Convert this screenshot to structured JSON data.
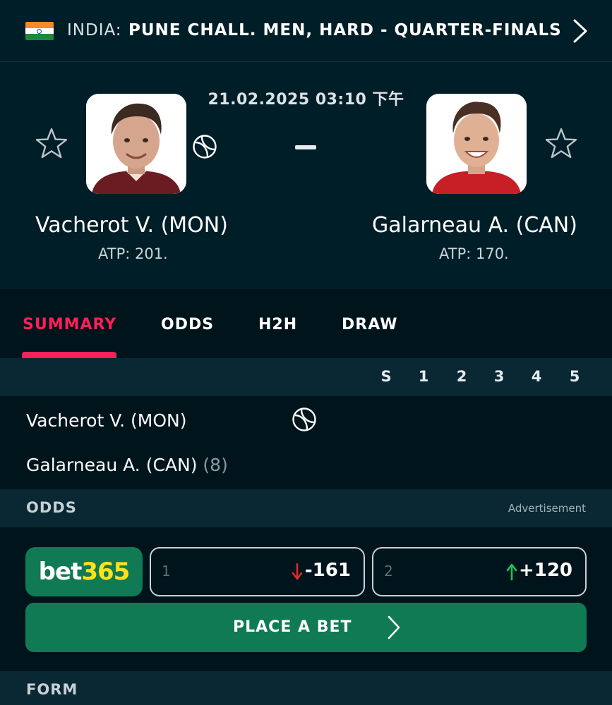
{
  "header": {
    "country": "INDIA:",
    "tournament": "PUNE CHALL. MEN, HARD - QUARTER-FINALS"
  },
  "match": {
    "datetime": "21.02.2025 03:10 下午",
    "score_separator": "-",
    "home": {
      "name": "Vacherot V. (MON)",
      "rank": "ATP: 201."
    },
    "away": {
      "name": "Galarneau A. (CAN)",
      "rank": "ATP: 170."
    }
  },
  "tabs": [
    {
      "label": "SUMMARY"
    },
    {
      "label": "ODDS"
    },
    {
      "label": "H2H"
    },
    {
      "label": "DRAW"
    }
  ],
  "scoreboard": {
    "columns": [
      "S",
      "1",
      "2",
      "3",
      "4",
      "5"
    ],
    "rows": [
      {
        "name": "Vacherot V. (MON)",
        "seed": ""
      },
      {
        "name": "Galarneau A. (CAN)",
        "seed": "(8)"
      }
    ]
  },
  "odds": {
    "title": "ODDS",
    "advertisement": "Advertisement",
    "bookmaker": {
      "part1": "bet",
      "part2": "365"
    },
    "options": [
      {
        "label": "1",
        "value": "-161",
        "trend": "down",
        "trend_color": "#e0282e"
      },
      {
        "label": "2",
        "value": "+120",
        "trend": "up",
        "trend_color": "#19c35b"
      }
    ],
    "place_bet": "PLACE A BET"
  },
  "form": {
    "title": "FORM"
  },
  "colors": {
    "accent": "#ff1f5a",
    "bookmaker_green": "#107a55",
    "background": "#001e28"
  }
}
